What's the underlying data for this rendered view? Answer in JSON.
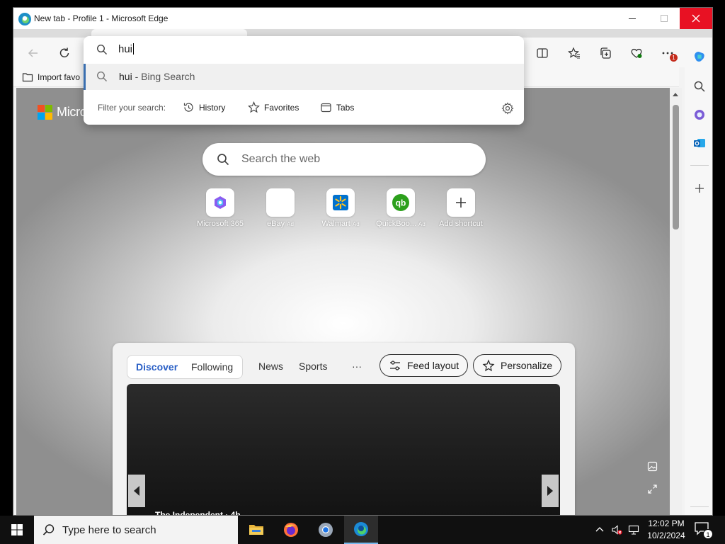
{
  "window": {
    "title": "New tab - Profile 1 - Microsoft Edge"
  },
  "favorites_bar": {
    "import_label": "Import favo"
  },
  "address_dropdown": {
    "typed_text": "hui",
    "suggestion": {
      "query": "hui",
      "source": " - Bing Search"
    },
    "filter_label": "Filter your search:",
    "filters": [
      "History",
      "Favorites",
      "Tabs"
    ]
  },
  "newtab": {
    "logo_text": "Micro",
    "search_placeholder": "Search the web",
    "shortcuts": [
      {
        "label": "Microsoft 365",
        "ad": ""
      },
      {
        "label": "eBay",
        "ad": "Ad"
      },
      {
        "label": "Walmart",
        "ad": "Ad"
      },
      {
        "label": "QuickBoo...",
        "ad": "Ad"
      },
      {
        "label": "Add shortcut",
        "ad": ""
      }
    ]
  },
  "feed": {
    "tabs": {
      "discover": "Discover",
      "following": "Following",
      "news": "News",
      "sports": "Sports",
      "more": "···"
    },
    "feed_layout_label": "Feed layout",
    "personalize_label": "Personalize",
    "hero_source": "The Independent · 4h"
  },
  "toolbar": {
    "notification_count": "1"
  },
  "taskbar": {
    "search_placeholder": "Type here to search",
    "time": "12:02 PM",
    "date": "10/2/2024",
    "notification_count": "1"
  },
  "colors": {
    "close_red": "#e81123",
    "accent_blue": "#2b60c6",
    "taskbar": "#101010"
  }
}
